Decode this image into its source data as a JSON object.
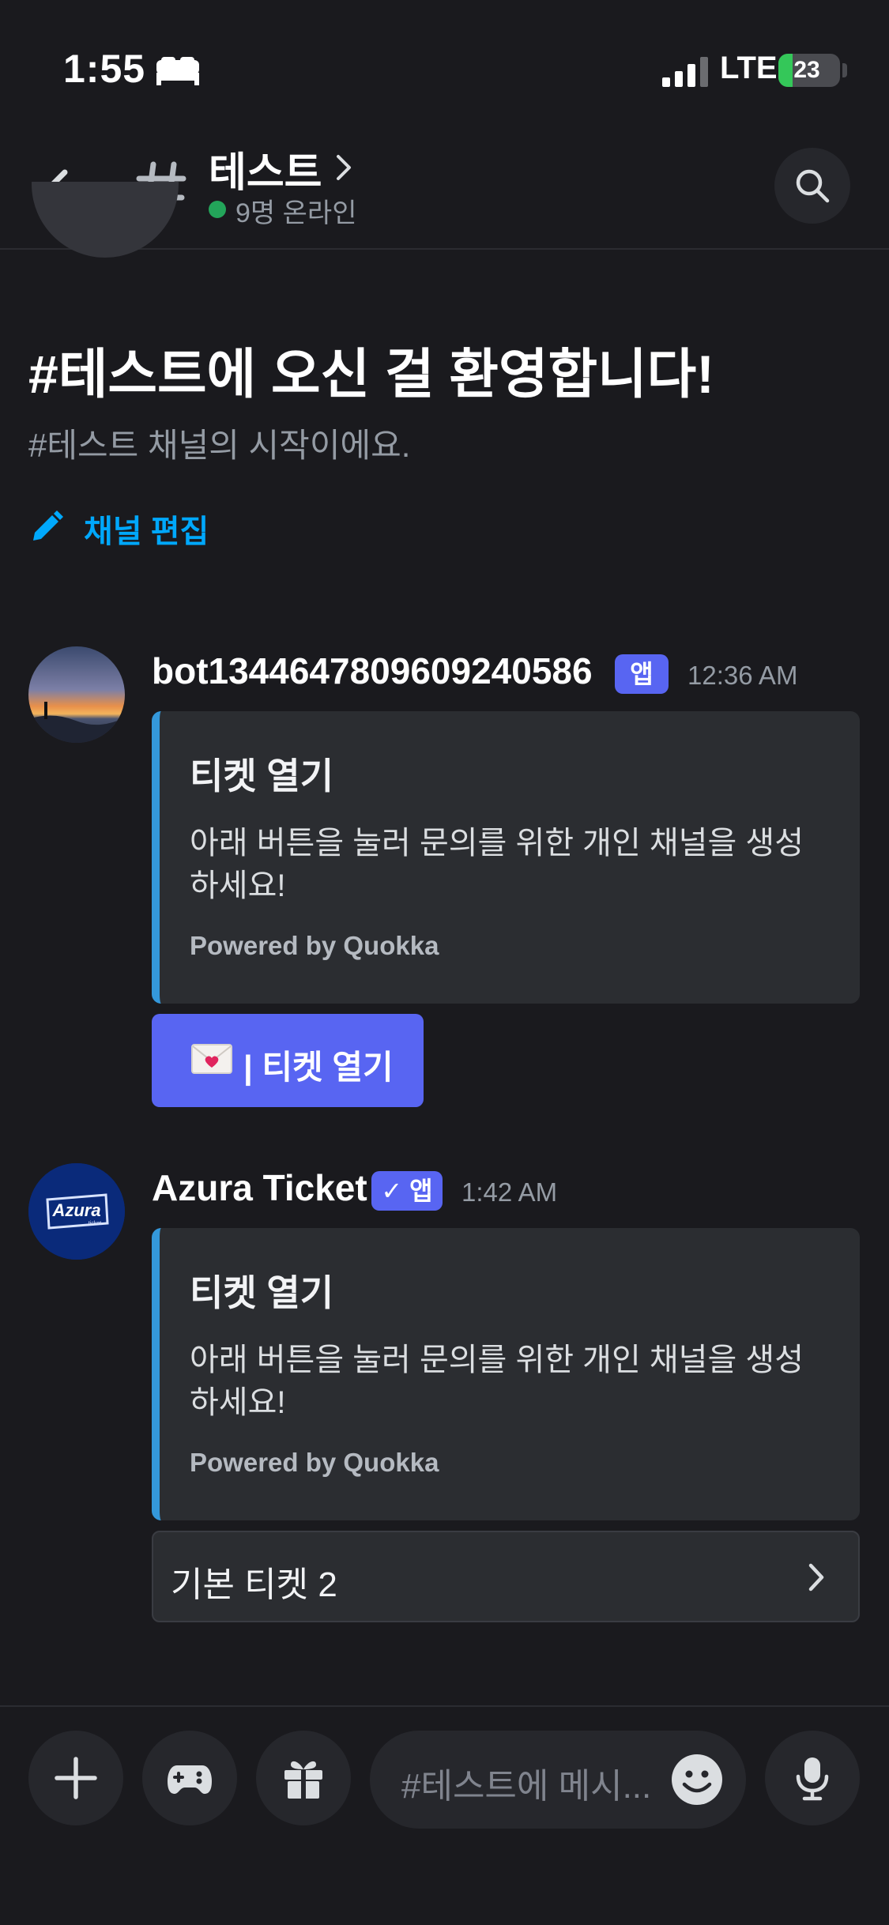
{
  "status_bar": {
    "time": "1:55",
    "network": "LTE",
    "battery": "23",
    "battery_level": 0.23,
    "icons": [
      "bed-icon",
      "signal-icon",
      "battery-icon"
    ]
  },
  "header": {
    "channel_name": "테스트",
    "online_status": "9명 온라인",
    "icons": [
      "back-arrow-icon",
      "hash-icon",
      "chevron-right-icon",
      "search-icon"
    ]
  },
  "welcome": {
    "title": "#테스트에 오신 걸 환영합니다!",
    "subtitle": "#테스트 채널의 시작이에요.",
    "edit_label": "채널 편집"
  },
  "messages": [
    {
      "author": "bot1344647809609240586",
      "badge": "앱",
      "time": "12:36 AM",
      "embed": {
        "title": "티켓 열기",
        "description": "아래 버튼을 눌러 문의를 위한 개인 채널을 생성하세요!",
        "footer": "Powered by Quokka"
      },
      "button_label": "| 티켓 열기",
      "button_icon": "love-letter-icon"
    },
    {
      "author": "Azura Ticket",
      "badge": "✓ 앱",
      "time": "1:42 AM",
      "avatar_text": "Azura",
      "avatar_subtext": "ticket",
      "embed": {
        "title": "티켓 열기",
        "description": "아래 버튼을 눌러 문의를 위한 개인 채널을 생성하세요!",
        "footer": "Powered by Quokka"
      },
      "select_label": "기본 티켓 2"
    }
  ],
  "composer": {
    "placeholder": "#테스트에 메시...",
    "icons": [
      "plus-icon",
      "gamepad-icon",
      "gift-icon",
      "emoji-icon",
      "microphone-icon"
    ]
  },
  "colors": {
    "background": "#1a1a1e",
    "blurple": "#5865f2",
    "embed_accent": "#3498db",
    "link_blue": "#00a8fc",
    "online_green": "#23a55a"
  }
}
